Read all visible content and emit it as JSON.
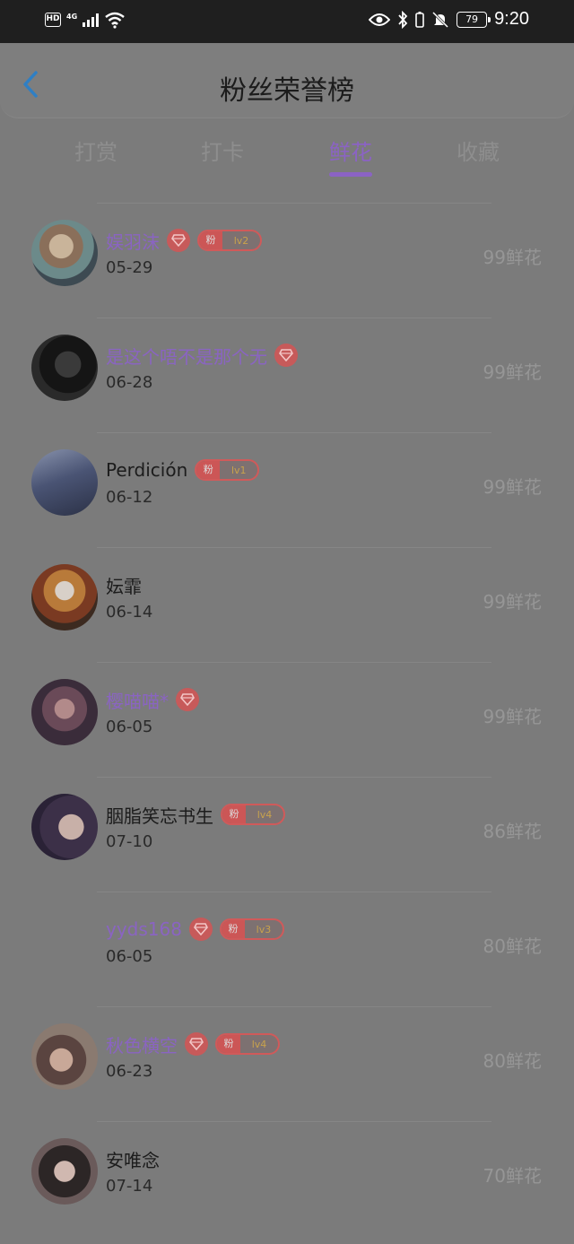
{
  "status_bar": {
    "hd": "HD",
    "network": "4G",
    "battery": "79",
    "time": "9:20"
  },
  "header": {
    "title": "粉丝荣誉榜"
  },
  "tabs": [
    {
      "label": "打赏"
    },
    {
      "label": "打卡"
    },
    {
      "label": "鲜花"
    },
    {
      "label": "收藏"
    }
  ],
  "active_tab": "鲜花",
  "fans": [
    {
      "name": "娱羽沫",
      "vip": true,
      "badge_text": "粉",
      "level": "lv2",
      "date": "05-29",
      "count": "99鲜花"
    },
    {
      "name": "是这个唔不是那个无",
      "vip": true,
      "badge_text": "",
      "level": "",
      "date": "06-28",
      "count": "99鲜花"
    },
    {
      "name": "Perdición",
      "vip": false,
      "badge_text": "粉",
      "level": "lv1",
      "date": "06-12",
      "count": "99鲜花"
    },
    {
      "name": "妘霏",
      "vip": false,
      "badge_text": "",
      "level": "",
      "date": "06-14",
      "count": "99鲜花"
    },
    {
      "name": "樱喵喵*",
      "vip": true,
      "badge_text": "",
      "level": "",
      "date": "06-05",
      "count": "99鲜花"
    },
    {
      "name": "胭脂笑忘书生",
      "vip": false,
      "badge_text": "粉",
      "level": "lv4",
      "date": "07-10",
      "count": "86鲜花"
    },
    {
      "name": "yyds168",
      "vip": true,
      "badge_text": "粉",
      "level": "lv3",
      "date": "06-05",
      "count": "80鲜花"
    },
    {
      "name": "秋色横空",
      "vip": true,
      "badge_text": "粉",
      "level": "lv4",
      "date": "06-23",
      "count": "80鲜花"
    },
    {
      "name": "安唯念",
      "vip": false,
      "badge_text": "",
      "level": "",
      "date": "07-14",
      "count": "70鲜花"
    }
  ],
  "colors": {
    "accent": "#8b63c4",
    "badge_red": "#d05a5a",
    "overlay": "#7b7b7b"
  }
}
